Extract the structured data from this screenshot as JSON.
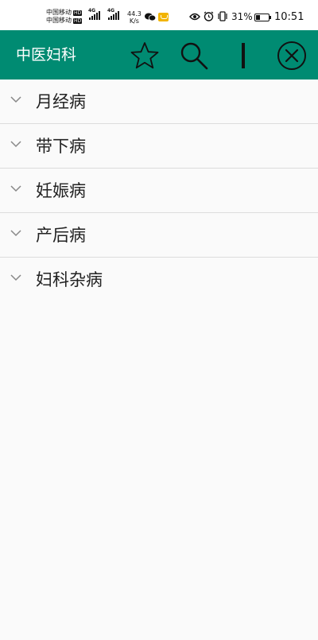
{
  "status_bar": {
    "carrier_1": "中国移动",
    "carrier_2": "中国移动",
    "hd_1": "HD",
    "hd_2": "HD",
    "network_1": "4G",
    "network_2": "4G",
    "net_speed": "44.3",
    "net_speed_unit": "K/s",
    "battery_percent": "31%",
    "time": "10:51"
  },
  "toolbar": {
    "title": "中医妇科",
    "background_color": "#008b72",
    "actions": [
      "star-icon",
      "search-icon",
      "cursor-icon",
      "close-circle-icon"
    ]
  },
  "categories": [
    {
      "label": "月经病"
    },
    {
      "label": "带下病"
    },
    {
      "label": "妊娠病"
    },
    {
      "label": "产后病"
    },
    {
      "label": "妇科杂病"
    }
  ]
}
